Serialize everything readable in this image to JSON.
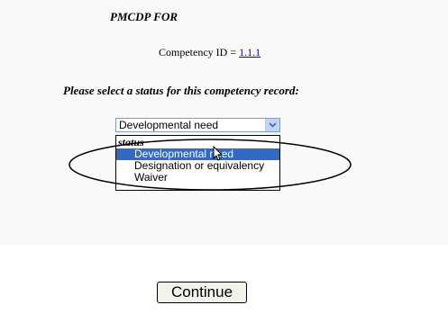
{
  "header": {
    "title": "PMCDP FOR"
  },
  "competency": {
    "label": "Competency ID = ",
    "id": "1.1.1"
  },
  "prompt": "Please select a status for this competency record:",
  "status_select": {
    "selected": "Developmental need",
    "group_label": "status",
    "options": [
      "Developmental need",
      "Designation or equivalency",
      "Waiver"
    ]
  },
  "actions": {
    "continue_label": "Continue"
  },
  "icons": {
    "dropdown": "chevron-down-icon",
    "cursor": "mouse-pointer-icon"
  },
  "colors": {
    "highlight": "#316ac5",
    "link": "#0000cc"
  }
}
